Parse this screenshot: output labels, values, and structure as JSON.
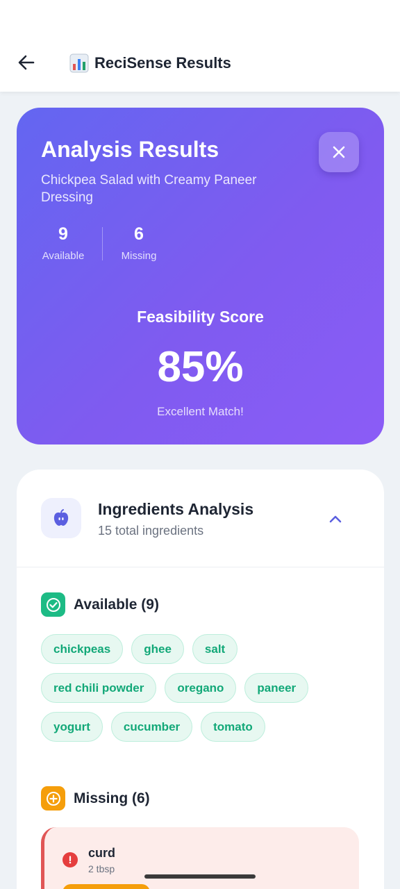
{
  "header": {
    "emoji": "📊",
    "title": "ReciSense Results"
  },
  "hero": {
    "title": "Analysis Results",
    "subtitle": "Chickpea Salad with Creamy Paneer Dressing",
    "stats": {
      "available": {
        "value": "9",
        "label": "Available"
      },
      "missing": {
        "value": "6",
        "label": "Missing"
      }
    },
    "feasibility": {
      "label": "Feasibility Score",
      "score": "85%",
      "description": "Excellent Match!"
    }
  },
  "ingredients": {
    "title": "Ingredients Analysis",
    "subtitle": "15 total ingredients",
    "available": {
      "title": "Available (9)",
      "items": [
        "chickpeas",
        "ghee",
        "salt",
        "red chili powder",
        "oregano",
        "paneer",
        "yogurt",
        "cucumber",
        "tomato"
      ]
    },
    "missing": {
      "title": "Missing (6)",
      "items": [
        {
          "name": "curd",
          "quantity": "2 tbsp"
        }
      ]
    }
  },
  "colors": {
    "accent": "#6366f1",
    "available_green": "#12a878",
    "missing_orange": "#f59e0b",
    "missing_red": "#e53e3e"
  }
}
